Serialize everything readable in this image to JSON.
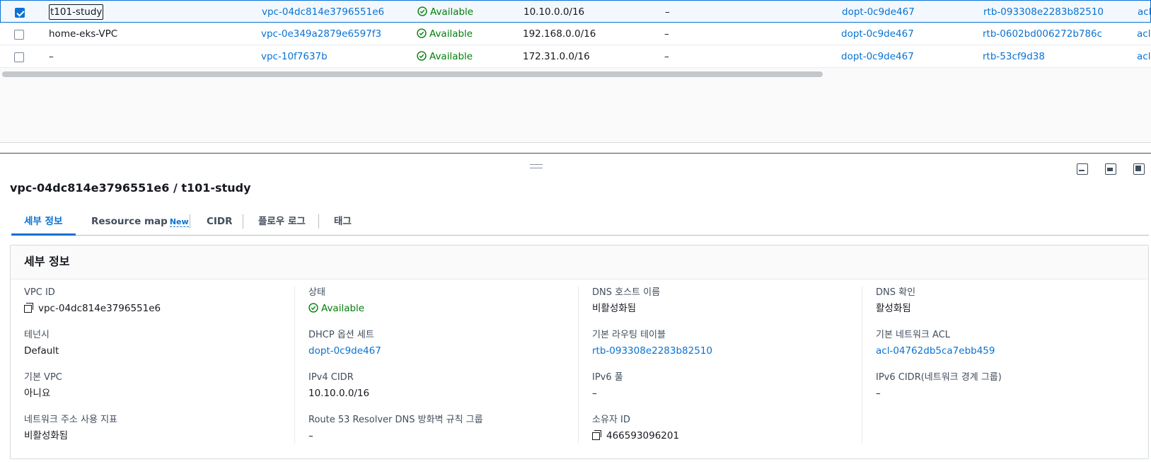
{
  "vpc_table": {
    "rows": [
      {
        "name": "t101-study",
        "vpc_id": "vpc-04dc814e3796551e6",
        "state": "Available",
        "ipv4_cidr": "10.10.0.0/16",
        "ipv6_cidr": "–",
        "dhcp": "dopt-0c9de467",
        "route_table": "rtb-093308e2283b82510",
        "acl": "acl",
        "selected": true
      },
      {
        "name": "home-eks-VPC",
        "vpc_id": "vpc-0e349a2879e6597f3",
        "state": "Available",
        "ipv4_cidr": "192.168.0.0/16",
        "ipv6_cidr": "–",
        "dhcp": "dopt-0c9de467",
        "route_table": "rtb-0602bd006272b786c",
        "acl": "acl",
        "selected": false
      },
      {
        "name": "–",
        "vpc_id": "vpc-10f7637b",
        "state": "Available",
        "ipv4_cidr": "172.31.0.0/16",
        "ipv6_cidr": "–",
        "dhcp": "dopt-0c9de467",
        "route_table": "rtb-53cf9d38",
        "acl": "acl",
        "selected": false
      }
    ]
  },
  "panel": {
    "title": "vpc-04dc814e3796551e6 / t101-study",
    "tabs": [
      {
        "label": "세부 정보",
        "active": true
      },
      {
        "label": "Resource map",
        "badge": "New"
      },
      {
        "label": "CIDR"
      },
      {
        "label": "플로우 로그"
      },
      {
        "label": "태그"
      }
    ]
  },
  "details": {
    "header": "세부 정보",
    "columns": [
      [
        {
          "key": "VPC ID",
          "value": "vpc-04dc814e3796551e6",
          "icon": "copy-icon"
        },
        {
          "key": "테넌시",
          "value": "Default"
        },
        {
          "key": "기본 VPC",
          "value": "아니요"
        },
        {
          "key": "네트워크 주소 사용 지표",
          "value": "비활성화됨"
        }
      ],
      [
        {
          "key": "상태",
          "value": "Available",
          "icon": "check-circle-icon"
        },
        {
          "key": "DHCP 옵션 세트",
          "value": "dopt-0c9de467",
          "link": true
        },
        {
          "key": "IPv4 CIDR",
          "value": "10.10.0.0/16"
        },
        {
          "key": "Route 53 Resolver DNS 방화벽 규칙 그룹",
          "value": "–"
        }
      ],
      [
        {
          "key": "DNS 호스트 이름",
          "value": "비활성화됨"
        },
        {
          "key": "기본 라우팅 테이블",
          "value": "rtb-093308e2283b82510",
          "link": true
        },
        {
          "key": "IPv6 풀",
          "value": "–"
        },
        {
          "key": "소유자 ID",
          "value": "466593096201",
          "icon": "copy-icon"
        }
      ],
      [
        {
          "key": "DNS 확인",
          "value": "활성화됨"
        },
        {
          "key": "기본 네트워크 ACL",
          "value": "acl-04762db5ca7ebb459",
          "link": true
        },
        {
          "key": "IPv6 CIDR(네트워크 경계 그룹)",
          "value": "–"
        }
      ]
    ]
  },
  "colors": {
    "link": "#0972d3",
    "success": "#037f0c",
    "text": "#16191f",
    "muted": "#414d5c"
  }
}
